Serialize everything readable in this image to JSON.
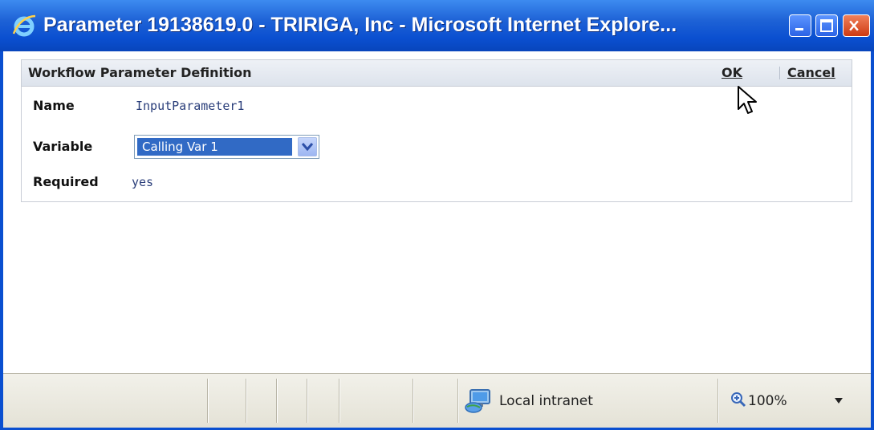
{
  "window": {
    "title": "Parameter 19138619.0 - TRIRIGA, Inc - Microsoft Internet Explore...",
    "icon": "ie-icon",
    "buttons": [
      "minimize-icon",
      "maximize-icon",
      "close-icon"
    ]
  },
  "panel": {
    "title": "Workflow Parameter Definition",
    "ok_label": "OK",
    "cancel_label": "Cancel"
  },
  "fields": {
    "name_label": "Name",
    "name_value": "InputParameter1",
    "variable_label": "Variable",
    "variable_value": "Calling Var 1",
    "required_label": "Required",
    "required_value": "yes"
  },
  "statusbar": {
    "zone_text": "Local intranet",
    "zoom_text": "100%"
  },
  "colors": {
    "titlebar": "#0a4fd0",
    "selection": "#316ac5",
    "value_text": "#2a3e7a"
  }
}
